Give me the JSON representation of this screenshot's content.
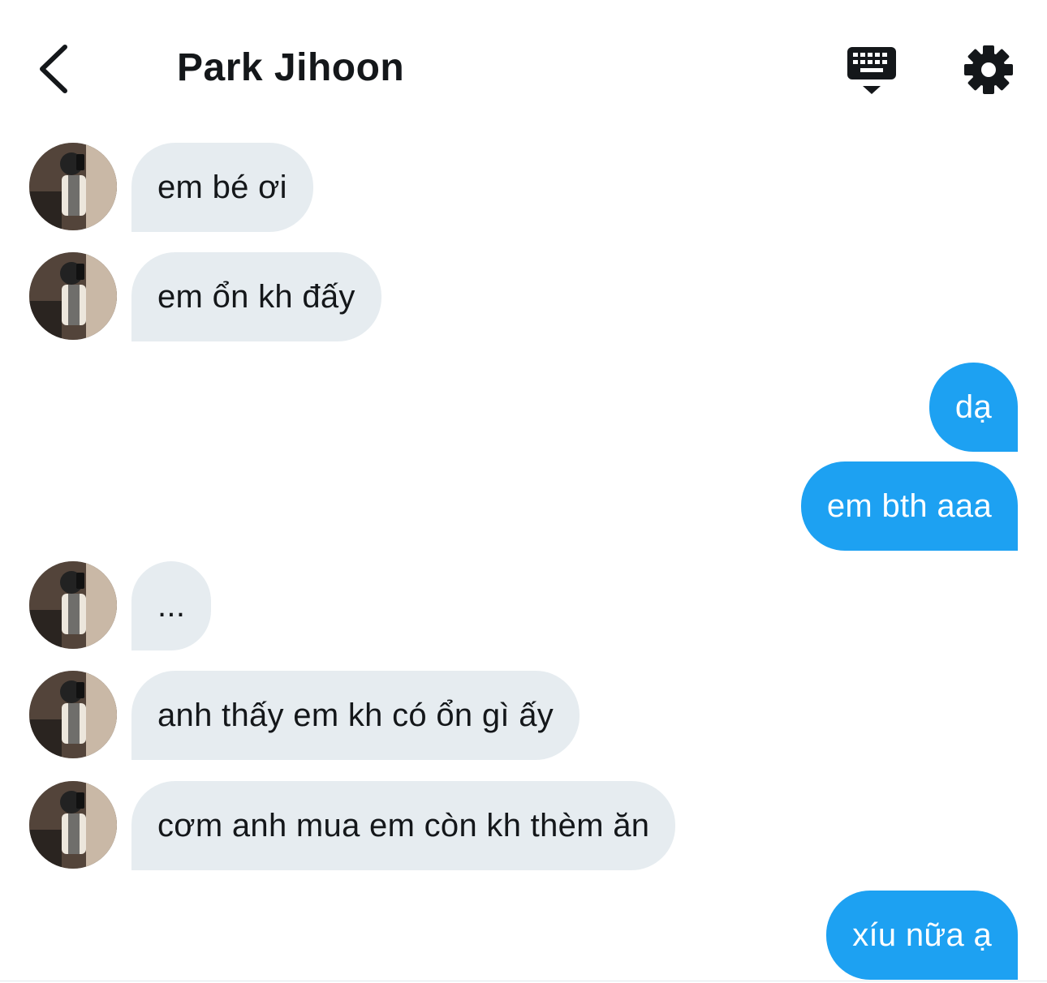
{
  "header": {
    "title": "Park Jihoon",
    "back_icon": "chevron-left-icon",
    "keyboard_icon": "keyboard-icon",
    "settings_icon": "gear-icon"
  },
  "colors": {
    "incoming_bubble": "#e6ecf0",
    "outgoing_bubble": "#1da1f2",
    "text_dark": "#14171a",
    "text_light": "#ffffff"
  },
  "messages": [
    {
      "sender": "them",
      "text": "em bé ơi"
    },
    {
      "sender": "them",
      "text": "em ổn kh đấy"
    },
    {
      "sender": "me",
      "text": "dạ"
    },
    {
      "sender": "me",
      "text": "em bth aaa"
    },
    {
      "sender": "them",
      "text": "..."
    },
    {
      "sender": "them",
      "text": "anh thấy em kh có ổn gì ấy"
    },
    {
      "sender": "them",
      "text": "cơm anh mua em còn kh thèm ăn"
    },
    {
      "sender": "me",
      "text": "xíu nữa ạ"
    }
  ]
}
